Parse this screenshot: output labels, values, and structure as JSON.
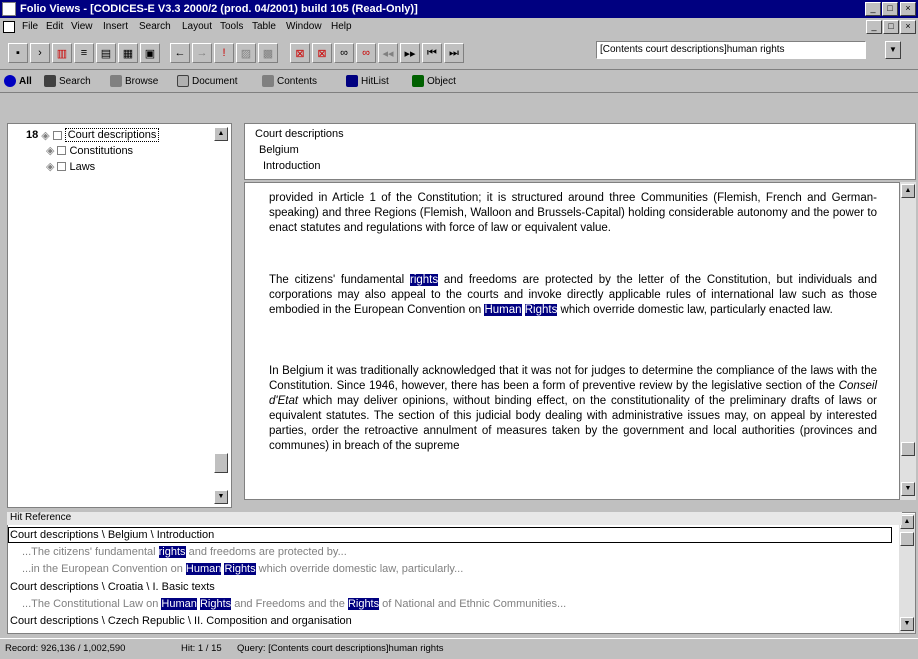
{
  "window": {
    "title": "Folio Views - [CODICES-E V3.3 2000/2 (prod. 04/2001) build 105  (Read-Only)]"
  },
  "menu": [
    "File",
    "Edit",
    "View",
    "Insert",
    "Search",
    "Layout",
    "Tools",
    "Table",
    "Window",
    "Help"
  ],
  "query": {
    "value": "[Contents court descriptions]human rights"
  },
  "tabs": [
    "All",
    "Search",
    "Browse",
    "Document",
    "Contents",
    "HitList",
    "Object"
  ],
  "tree": {
    "hit_count": "18",
    "items": [
      "Court descriptions",
      "Constitutions",
      "Laws"
    ]
  },
  "breadcrumbs": [
    "Court descriptions",
    "Belgium",
    "Introduction"
  ],
  "document": {
    "p1": "provided in Article 1 of the Constitution; it is structured around three Communities (Flemish, French and German-speaking) and three Regions (Flemish, Walloon and Brussels-Capital) holding considerable autonomy and the power to enact statutes and regulations with force of law or equivalent value.",
    "p2a": "The citizens' fundamental ",
    "p2_hit1": "rights",
    "p2b": " and freedoms are protected by the letter of the Constitution, but individuals and corporations may also appeal to the courts and invoke directly applicable rules of international law such as those embodied in the European Convention on ",
    "p2_hit2": "Human",
    "p2_hit3": "Rights",
    "p2c": " which override domestic law, particularly enacted law.",
    "p3a": "In Belgium it was traditionally acknowledged that it was not for judges to determine the compliance of the laws with the Constitution. Since 1946, however, there has been a form of preventive review by the legislative section of the ",
    "p3_italic": "Conseil d'Etat",
    "p3b": " which may deliver opinions, without binding effect, on the constitutionality of the preliminary drafts of laws or equivalent statutes. The section of this judicial body dealing with administrative issues may, on appeal by interested parties, order the retroactive annulment of measures taken by the government and local authorities (provinces and communes) in breach of the supreme"
  },
  "hits": {
    "header": "Hit Reference",
    "r1": "Court descriptions \\ Belgium \\ Introduction",
    "r1c1a": "...The citizens' fundamental ",
    "r1c1h": "rights",
    "r1c1b": " and freedoms are protected by...",
    "r1c2a": "...in the European Convention on ",
    "r1c2h1": "Human",
    "r1c2h2": "Rights",
    "r1c2b": " which override domestic law, particularly...",
    "r2": "Court descriptions \\ Croatia \\ I. Basic texts",
    "r2c1a": "...The Constitutional Law on ",
    "r2c1h1": "Human",
    "r2c1h2": "Rights",
    "r2c1b": " and Freedoms and the ",
    "r2c1h3": "Rights",
    "r2c1c": " of National and Ethnic Communities...",
    "r3": "Court descriptions \\ Czech Republic \\ II. Composition and organisation"
  },
  "status": {
    "record": "Record: 926,136 / 1,002,590",
    "hit": "Hit: 1 / 15",
    "query": "Query: [Contents court descriptions]human rights"
  },
  "colors": {
    "titlebar": "#000080",
    "highlight": "#000080"
  }
}
